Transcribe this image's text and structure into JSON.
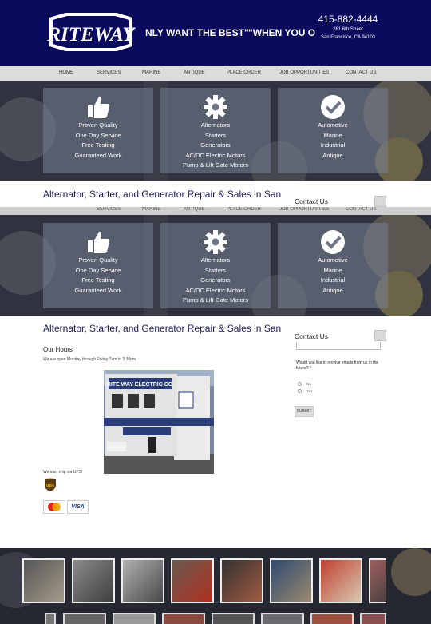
{
  "header": {
    "logo_text": "RITEWAY",
    "tagline_1": "NLY WANT THE BEST\"",
    "tagline_2": "\"WHEN YOU O",
    "phone": "415-882-4444",
    "street": "261 6th Street",
    "city": "San Francisco, CA 94103"
  },
  "nav": {
    "items": [
      "HOME",
      "SERVICES",
      "MARINE",
      "ANTIQUE",
      "PLACE ORDER",
      "JOB OPPORTUNITIES",
      "CONTACT US"
    ]
  },
  "cards": [
    {
      "icon": "thumbs-up-icon",
      "lines": [
        "Proven Quality",
        "One Day Service",
        "Free Testing",
        "Guaranteed Work"
      ]
    },
    {
      "icon": "gear-icon",
      "lines": [
        "Alternators",
        "Starters",
        "Generators",
        "AC/DC Electric Motors",
        "Pump & Lift Gate Motors"
      ]
    },
    {
      "icon": "checkmark-icon",
      "lines": [
        "Automotive",
        "Marine",
        "Industrial",
        "Antique"
      ]
    }
  ],
  "main": {
    "title": "Alternator, Starter, and Generator Repair & Sales in San Francisco, CA",
    "hours_heading": "Our Hours",
    "hours_text": "We are open Monday through Friday 7am to 3:30pm.",
    "ship_text": "We also ship via UPS!",
    "visa": "VISA",
    "ups": "ups",
    "building_sign": "RITE WAY ELECTRIC CO."
  },
  "contact": {
    "heading": "Contact Us",
    "question": "Would you like to receive emails from us in the future?",
    "required": "*",
    "option_no": "No",
    "option_yes": "Yes",
    "submit": "SUBMIT"
  },
  "colors": {
    "header_bg": "#0b0b5e",
    "title": "#1a1a5a",
    "nav_bg": "#dcdcdc"
  }
}
